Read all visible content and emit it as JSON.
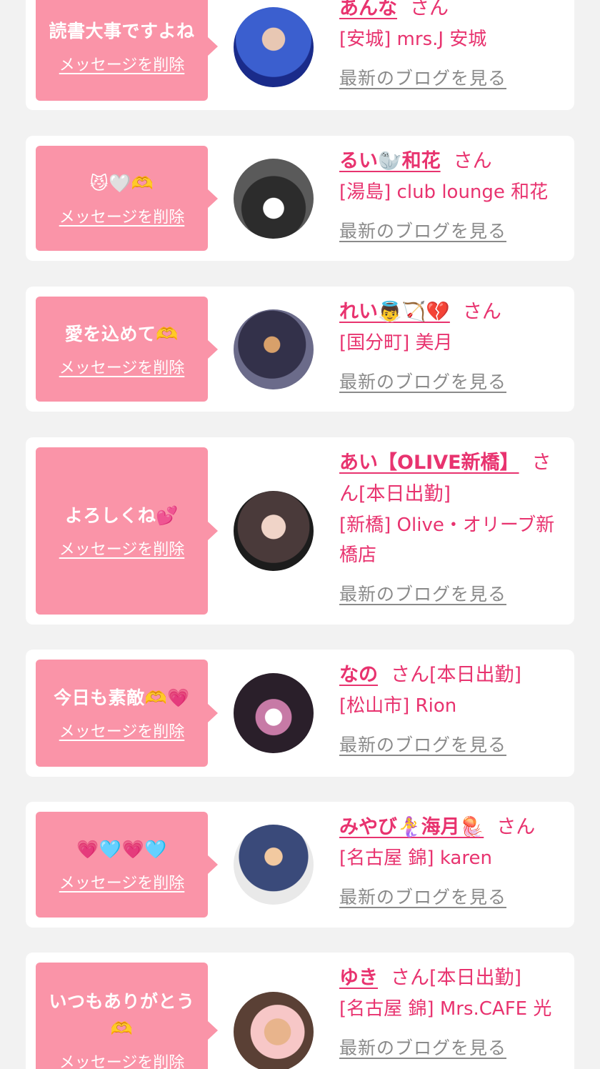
{
  "items": [
    {
      "message": "読書大事ですよね",
      "delete_label": "メッセージを削除",
      "name": "あんな",
      "suffix": "さん",
      "shop": "[安城] mrs.J 安城",
      "blog_label": "最新のブログを見る",
      "avatar_icon": "avatar-photo"
    },
    {
      "message": "😼🤍🫶",
      "delete_label": "メッセージを削除",
      "name": "るい🦭和花",
      "suffix": "さん",
      "shop": "[湯島] club lounge 和花",
      "blog_label": "最新のブログを見る",
      "avatar_icon": "avatar-photo"
    },
    {
      "message": "愛を込めて🫶",
      "delete_label": "メッセージを削除",
      "name": "れい👼🏹💔",
      "suffix": "さん",
      "shop": "[国分町] 美月",
      "blog_label": "最新のブログを見る",
      "avatar_icon": "avatar-photo"
    },
    {
      "message": "よろしくね💕",
      "delete_label": "メッセージを削除",
      "name": "あい【OLIVE新橋】",
      "suffix": "さん[本日出勤]",
      "shop": "[新橋] Olive・オリーブ新橋店",
      "blog_label": "最新のブログを見る",
      "avatar_icon": "avatar-photo"
    },
    {
      "message": "今日も素敵🫶💗",
      "delete_label": "メッセージを削除",
      "name": "なの",
      "suffix": "さん[本日出勤]",
      "shop": "[松山市] Rion",
      "blog_label": "最新のブログを見る",
      "avatar_icon": "avatar-photo"
    },
    {
      "message": "💗🩵💗🩵",
      "delete_label": "メッセージを削除",
      "name": "みやび🧜‍♀️海月🪼",
      "suffix": "さん",
      "shop": "[名古屋 錦] karen",
      "blog_label": "最新のブログを見る",
      "avatar_icon": "avatar-photo"
    },
    {
      "message": "いつもありがとう🫶",
      "delete_label": "メッセージを削除",
      "name": "ゆき",
      "suffix": "さん[本日出勤]",
      "shop": "[名古屋 錦] Mrs.CAFE 光",
      "blog_label": "最新のブログを見る",
      "avatar_icon": "avatar-photo"
    }
  ],
  "colors": {
    "page_bg": "#f2f2f2",
    "card_bg": "#ffffff",
    "bubble": "#fa94a8",
    "accent": "#e8336f",
    "link_gray": "#8a8a8a"
  }
}
